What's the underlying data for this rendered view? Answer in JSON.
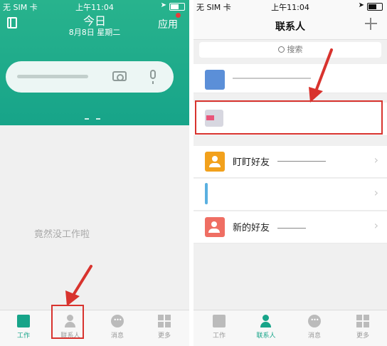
{
  "status": {
    "carrier": "无 SIM 卡",
    "time": "上午11:04"
  },
  "left": {
    "header": {
      "title": "今日",
      "date": "8月8日 星期二",
      "apps_label": "应用"
    },
    "empty_message": "竟然没工作啦"
  },
  "right": {
    "header": {
      "title": "联系人"
    },
    "search": {
      "placeholder": "搜索"
    },
    "list": [
      {
        "label": "",
        "avatar": "blue-building-icon"
      },
      {
        "label": "",
        "avatar": "pink-org-icon"
      },
      {
        "label": "盯盯好友",
        "avatar": "orange-person-icon"
      },
      {
        "label": "",
        "avatar": "blue-bar-icon"
      },
      {
        "label": "新的好友",
        "avatar": "red-add-person-icon"
      }
    ]
  },
  "tabs": [
    {
      "label": "工作",
      "icon": "work-icon"
    },
    {
      "label": "联系人",
      "icon": "contacts-icon"
    },
    {
      "label": "消息",
      "icon": "message-icon"
    },
    {
      "label": "更多",
      "icon": "more-icon"
    }
  ],
  "colors": {
    "brand_green": "#17a489",
    "highlight_red": "#d8332e",
    "tab_inactive": "#999999"
  }
}
